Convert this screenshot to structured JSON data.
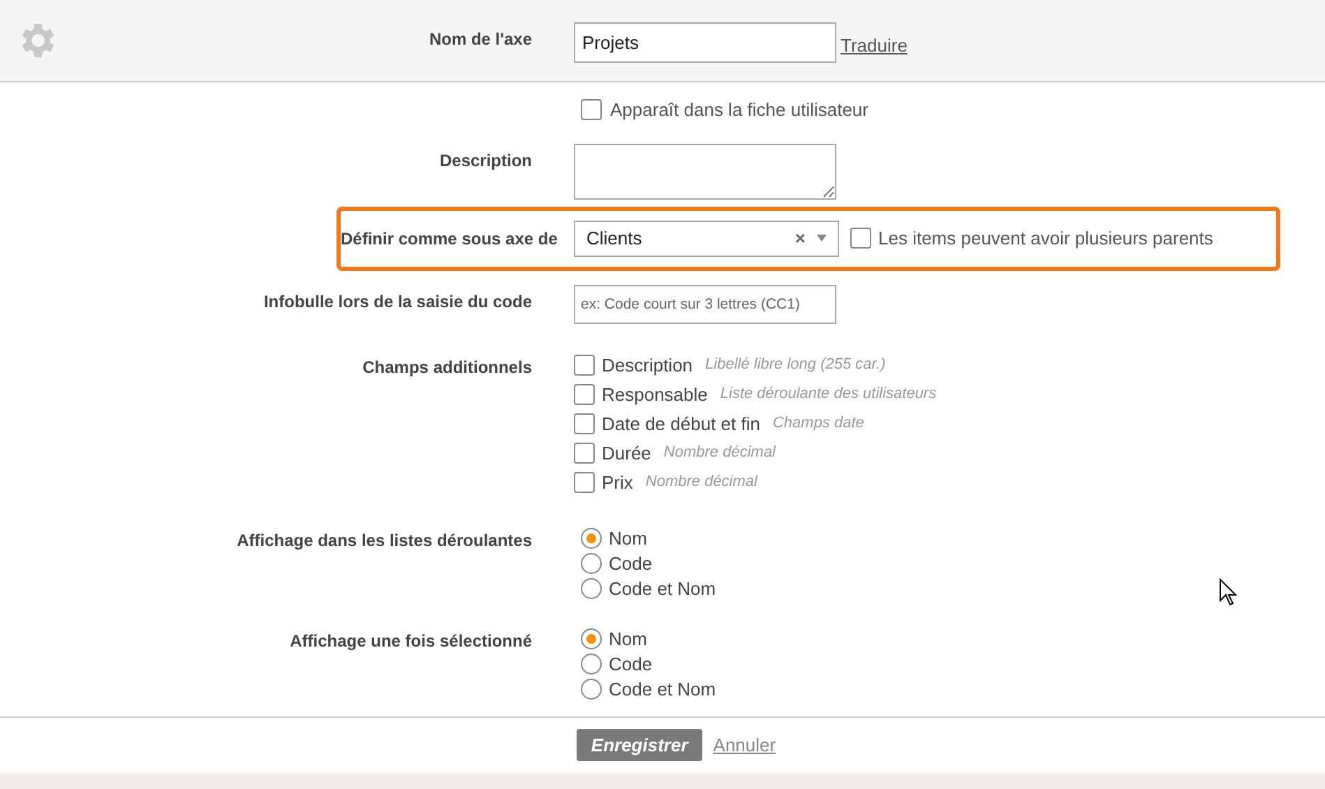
{
  "header": {
    "label": "Nom de l'axe",
    "value": "Projets",
    "link": "Traduire"
  },
  "user_sheet": {
    "label": "Apparaît dans la fiche utilisateur",
    "checked": false
  },
  "description": {
    "label": "Description"
  },
  "parent_axis": {
    "label": "Définir comme sous axe de",
    "value": "Clients",
    "clear": "×",
    "multi_parent": {
      "label": "Les items peuvent avoir plusieurs parents",
      "checked": false
    }
  },
  "tooltip": {
    "label": "Infobulle lors de la saisie du code",
    "placeholder": "ex: Code court sur 3 lettres (CC1)"
  },
  "extra_fields": {
    "label": "Champs additionnels",
    "items": [
      {
        "label": "Description",
        "hint": "Libellé libre long (255 car.)",
        "checked": false
      },
      {
        "label": "Responsable",
        "hint": "Liste déroulante des utilisateurs",
        "checked": false
      },
      {
        "label": "Date de début et fin",
        "hint": "Champs date",
        "checked": false
      },
      {
        "label": "Durée",
        "hint": "Nombre décimal",
        "checked": false
      },
      {
        "label": "Prix",
        "hint": "Nombre décimal",
        "checked": false
      }
    ]
  },
  "radio_groups": [
    {
      "label": "Affichage dans les listes déroulantes",
      "options": [
        {
          "label": "Nom",
          "selected": true
        },
        {
          "label": "Code",
          "selected": false
        },
        {
          "label": "Code et Nom",
          "selected": false
        }
      ]
    },
    {
      "label": "Affichage une fois sélectionné",
      "options": [
        {
          "label": "Nom",
          "selected": true
        },
        {
          "label": "Code",
          "selected": false
        },
        {
          "label": "Code et Nom",
          "selected": false
        }
      ]
    }
  ],
  "footer": {
    "save": "Enregistrer",
    "cancel": "Annuler"
  }
}
